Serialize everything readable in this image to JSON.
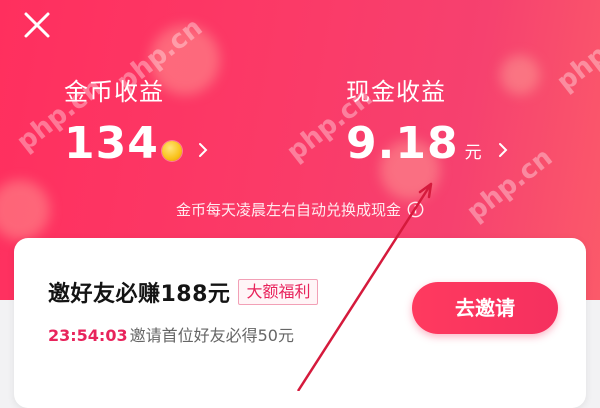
{
  "colors": {
    "brand": "#ff2f5e",
    "accent_text": "#e8245c",
    "white": "#ffffff"
  },
  "header": {
    "close_icon": "close-icon",
    "coin_stat": {
      "label": "金币收益",
      "value": "134",
      "icon": "coin-icon"
    },
    "cash_stat": {
      "label": "现金收益",
      "value": "9.18",
      "unit": "元"
    },
    "notice": "金币每天凌晨左右自动兑换成现金",
    "notice_icon": "info-icon"
  },
  "invite_card": {
    "title": "邀好友必赚188元",
    "badge": "大额福利",
    "timer": "23:54:03",
    "subtitle": "邀请首位好友必得50元",
    "button_label": "去邀请"
  },
  "watermark": "php.cn"
}
